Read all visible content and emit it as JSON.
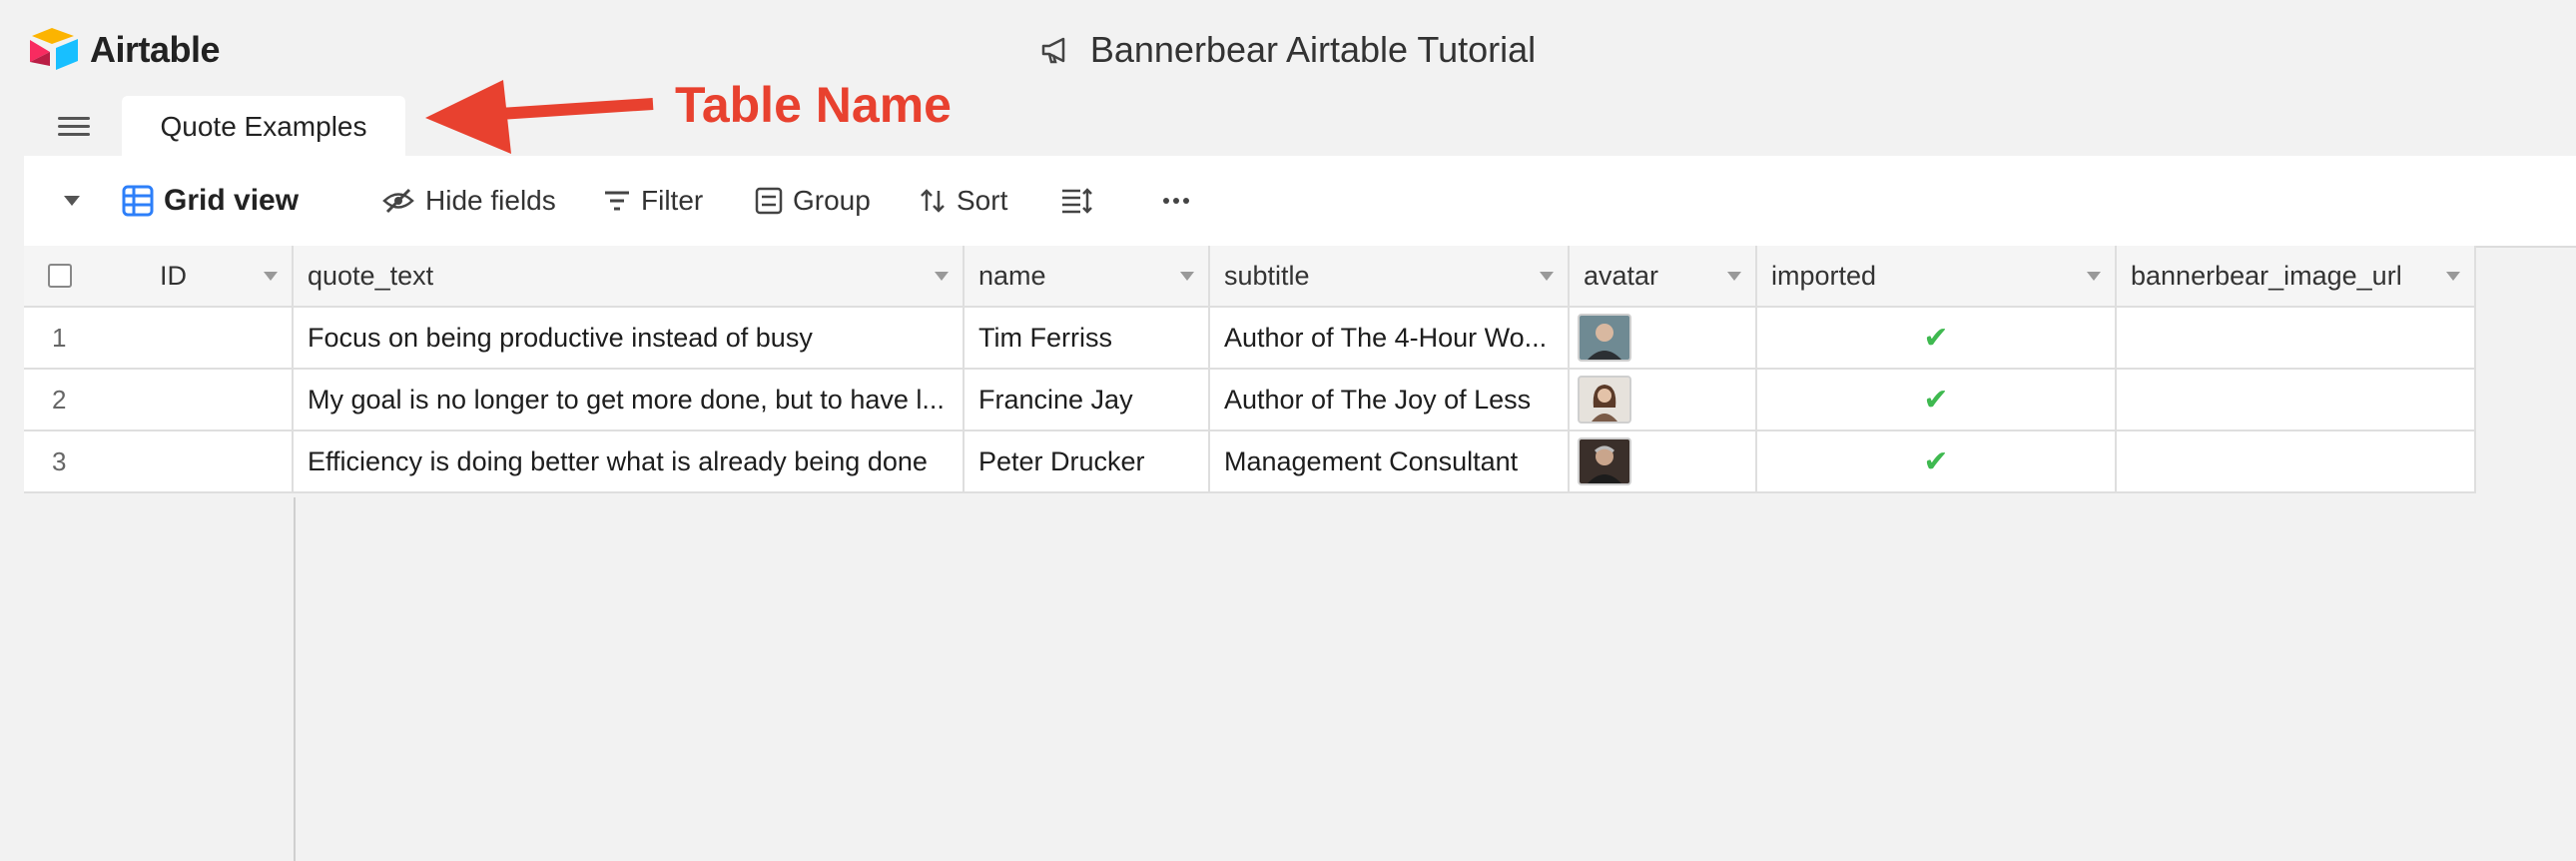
{
  "app": {
    "name": "Airtable",
    "base_title": "Bannerbear Airtable Tutorial"
  },
  "tabs": [
    {
      "label": "Quote Examples"
    }
  ],
  "annotation": {
    "label": "Table Name",
    "color": "#e8412f"
  },
  "toolbar": {
    "view_label": "Grid view",
    "hide_fields": "Hide fields",
    "filter": "Filter",
    "group": "Group",
    "sort": "Sort"
  },
  "table": {
    "columns": [
      "ID",
      "quote_text",
      "name",
      "subtitle",
      "avatar",
      "imported",
      "bannerbear_image_url"
    ],
    "rows": [
      {
        "num": "1",
        "quote_text": "Focus on being productive instead of busy",
        "name": "Tim Ferriss",
        "subtitle": "Author of The 4-Hour Wo...",
        "imported": true
      },
      {
        "num": "2",
        "quote_text": "My goal is no longer to get more done, but to have l...",
        "name": "Francine Jay",
        "subtitle": "Author of The Joy of Less",
        "imported": true
      },
      {
        "num": "3",
        "quote_text": "Efficiency is doing better what is already being done",
        "name": "Peter Drucker",
        "subtitle": "Management Consultant",
        "imported": true
      }
    ]
  },
  "colors": {
    "check": "#3fb950",
    "view_icon": "#2d7ff9"
  }
}
